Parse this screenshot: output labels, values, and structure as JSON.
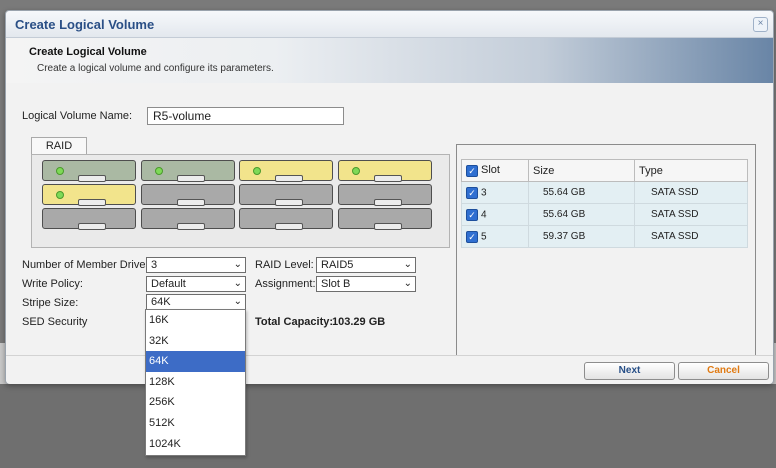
{
  "dialog": {
    "title": "Create Logical Volume",
    "close_glyph": "×",
    "header": {
      "title": "Create Logical Volume",
      "subtitle": "Create a logical volume and configure its parameters."
    }
  },
  "form": {
    "name_label": "Logical Volume Name:",
    "name_value": "R5-volume",
    "tab_label": "RAID",
    "member_drives_label": "Number of Member Drives:",
    "member_drives_value": "3",
    "raid_level_label": "RAID Level:",
    "raid_level_value": "RAID5",
    "write_policy_label": "Write Policy:",
    "write_policy_value": "Default",
    "assignment_label": "Assignment:",
    "assignment_value": "Slot B",
    "stripe_size_label": "Stripe Size:",
    "stripe_size_value": "64K",
    "sed_security_label": "SED Security",
    "total_capacity_label": "Total Capacity:",
    "total_capacity_value": "103.29 GB"
  },
  "drive_bays": [
    {
      "state": "green"
    },
    {
      "state": "green"
    },
    {
      "state": "yellow"
    },
    {
      "state": "yellow"
    },
    {
      "state": "yellow"
    },
    {
      "state": "empty"
    },
    {
      "state": "empty"
    },
    {
      "state": "empty"
    },
    {
      "state": "empty"
    },
    {
      "state": "empty"
    },
    {
      "state": "empty"
    },
    {
      "state": "empty"
    }
  ],
  "slot_table": {
    "headers": {
      "slot": "Slot",
      "size": "Size",
      "type": "Type"
    },
    "rows": [
      {
        "slot": "3",
        "size": "55.64 GB",
        "type": "SATA SSD"
      },
      {
        "slot": "4",
        "size": "55.64 GB",
        "type": "SATA SSD"
      },
      {
        "slot": "5",
        "size": "59.37 GB",
        "type": "SATA SSD"
      }
    ]
  },
  "stripe_dropdown": {
    "options": [
      "16K",
      "32K",
      "64K",
      "128K",
      "256K",
      "512K",
      "1024K"
    ],
    "selected": "64K"
  },
  "buttons": {
    "next": "Next",
    "cancel": "Cancel"
  },
  "glyphs": {
    "check": "✓",
    "chevron": "⌄"
  },
  "colors": {
    "accent": "#2a4f86",
    "selected": "#3d6cc6",
    "cancel": "#e07a12"
  }
}
